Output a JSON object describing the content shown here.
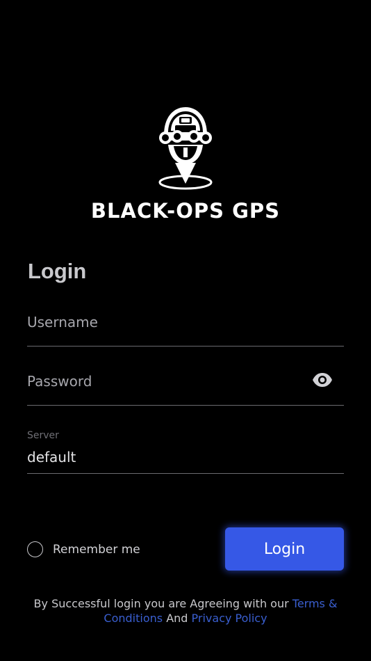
{
  "app": {
    "brand_name": "BLACK-OPS GPS",
    "logo_icon": "helmet-pin-logo-icon"
  },
  "form": {
    "heading": "Login",
    "username": {
      "placeholder": "Username",
      "value": ""
    },
    "password": {
      "placeholder": "Password",
      "value": "",
      "toggle_icon": "eye-icon"
    },
    "server": {
      "label": "Server",
      "value": "default"
    },
    "remember_label": "Remember me",
    "remember_checked": false,
    "submit_label": "Login"
  },
  "footer": {
    "prefix": "By Successful login you are Agreeing with our ",
    "terms_link": "Terms & Conditions",
    "joiner": " And ",
    "privacy_link": "Privacy Policy"
  },
  "colors": {
    "background": "#000000",
    "accent": "#3658e6",
    "link": "#3a5fd0",
    "heading": "#c9c9cd",
    "divider": "#6b6b70"
  }
}
